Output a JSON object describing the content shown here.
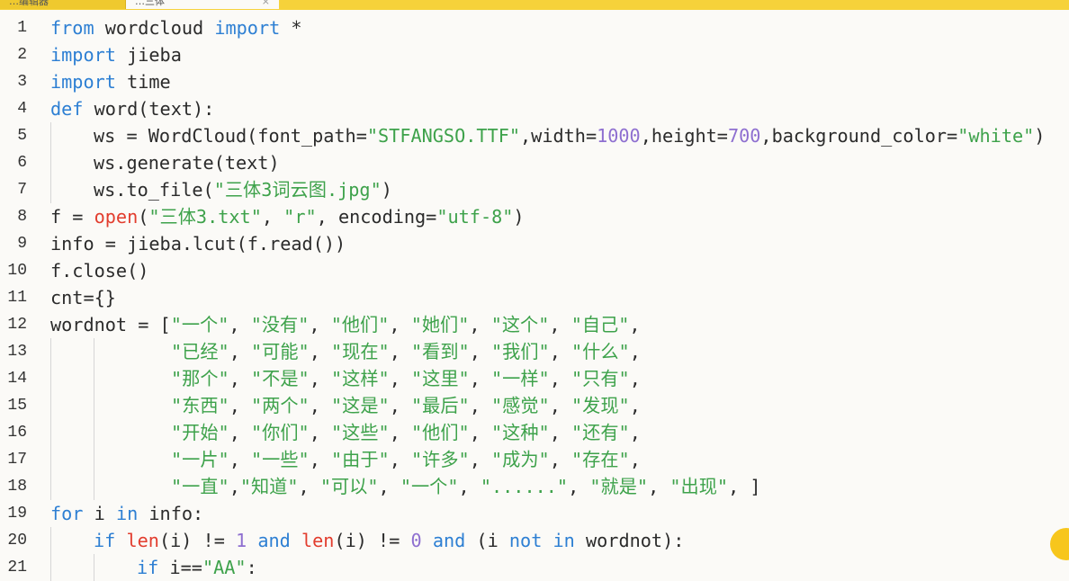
{
  "tabs": [
    {
      "label": "…编辑器"
    },
    {
      "label": "…三体",
      "close_label": "×"
    }
  ],
  "colors": {
    "keyword": "#2d7fd3",
    "string": "#3ea24b",
    "number": "#8e6fd0",
    "builtin": "#e23d2e",
    "text": "#2b2b2b",
    "tabbar": "#f6d23a"
  },
  "editor": {
    "language": "python",
    "lines": [
      {
        "n": "1",
        "indent": 0,
        "tokens": [
          [
            "kw",
            "from"
          ],
          [
            "t",
            " wordcloud "
          ],
          [
            "kw",
            "import"
          ],
          [
            "t",
            " *"
          ]
        ]
      },
      {
        "n": "2",
        "indent": 0,
        "tokens": [
          [
            "kw",
            "import"
          ],
          [
            "t",
            " jieba"
          ]
        ]
      },
      {
        "n": "3",
        "indent": 0,
        "tokens": [
          [
            "kw",
            "import"
          ],
          [
            "t",
            " time"
          ]
        ]
      },
      {
        "n": "4",
        "indent": 0,
        "tokens": [
          [
            "kw",
            "def"
          ],
          [
            "t",
            " word(text):"
          ]
        ]
      },
      {
        "n": "5",
        "indent": 1,
        "tokens": [
          [
            "t",
            "ws = WordCloud(font_path="
          ],
          [
            "str",
            "\"STFANGSO.TTF\""
          ],
          [
            "t",
            ",width="
          ],
          [
            "num",
            "1000"
          ],
          [
            "t",
            ",height="
          ],
          [
            "num",
            "700"
          ],
          [
            "t",
            ",background_color="
          ],
          [
            "str",
            "\"white\""
          ],
          [
            "t",
            ")"
          ]
        ]
      },
      {
        "n": "6",
        "indent": 1,
        "tokens": [
          [
            "t",
            "ws.generate(text)"
          ]
        ]
      },
      {
        "n": "7",
        "indent": 1,
        "tokens": [
          [
            "t",
            "ws.to_file("
          ],
          [
            "str",
            "\"三体3词云图.jpg\""
          ],
          [
            "t",
            ")"
          ]
        ]
      },
      {
        "n": "8",
        "indent": 0,
        "tokens": [
          [
            "t",
            "f = "
          ],
          [
            "bi",
            "open"
          ],
          [
            "t",
            "("
          ],
          [
            "str",
            "\"三体3.txt\""
          ],
          [
            "t",
            ", "
          ],
          [
            "str",
            "\"r\""
          ],
          [
            "t",
            ", encoding="
          ],
          [
            "str",
            "\"utf-8\""
          ],
          [
            "t",
            ")"
          ]
        ]
      },
      {
        "n": "9",
        "indent": 0,
        "tokens": [
          [
            "t",
            "info = jieba.lcut(f.read())"
          ]
        ]
      },
      {
        "n": "10",
        "indent": 0,
        "tokens": [
          [
            "t",
            "f.close()"
          ]
        ]
      },
      {
        "n": "11",
        "indent": 0,
        "tokens": [
          [
            "t",
            "cnt={}"
          ]
        ]
      },
      {
        "n": "12",
        "indent": 0,
        "tokens": [
          [
            "t",
            "wordnot = ["
          ],
          [
            "str",
            "\"一个\""
          ],
          [
            "t",
            ", "
          ],
          [
            "str",
            "\"没有\""
          ],
          [
            "t",
            ", "
          ],
          [
            "str",
            "\"他们\""
          ],
          [
            "t",
            ", "
          ],
          [
            "str",
            "\"她们\""
          ],
          [
            "t",
            ", "
          ],
          [
            "str",
            "\"这个\""
          ],
          [
            "t",
            ", "
          ],
          [
            "str",
            "\"自己\""
          ],
          [
            "t",
            ","
          ]
        ]
      },
      {
        "n": "13",
        "indent": 0,
        "cont": true,
        "tokens": [
          [
            "str",
            "\"已经\""
          ],
          [
            "t",
            ", "
          ],
          [
            "str",
            "\"可能\""
          ],
          [
            "t",
            ", "
          ],
          [
            "str",
            "\"现在\""
          ],
          [
            "t",
            ", "
          ],
          [
            "str",
            "\"看到\""
          ],
          [
            "t",
            ", "
          ],
          [
            "str",
            "\"我们\""
          ],
          [
            "t",
            ", "
          ],
          [
            "str",
            "\"什么\""
          ],
          [
            "t",
            ","
          ]
        ]
      },
      {
        "n": "14",
        "indent": 0,
        "cont": true,
        "tokens": [
          [
            "str",
            "\"那个\""
          ],
          [
            "t",
            ", "
          ],
          [
            "str",
            "\"不是\""
          ],
          [
            "t",
            ", "
          ],
          [
            "str",
            "\"这样\""
          ],
          [
            "t",
            ", "
          ],
          [
            "str",
            "\"这里\""
          ],
          [
            "t",
            ", "
          ],
          [
            "str",
            "\"一样\""
          ],
          [
            "t",
            ", "
          ],
          [
            "str",
            "\"只有\""
          ],
          [
            "t",
            ","
          ]
        ]
      },
      {
        "n": "15",
        "indent": 0,
        "cont": true,
        "tokens": [
          [
            "str",
            "\"东西\""
          ],
          [
            "t",
            ", "
          ],
          [
            "str",
            "\"两个\""
          ],
          [
            "t",
            ", "
          ],
          [
            "str",
            "\"这是\""
          ],
          [
            "t",
            ", "
          ],
          [
            "str",
            "\"最后\""
          ],
          [
            "t",
            ", "
          ],
          [
            "str",
            "\"感觉\""
          ],
          [
            "t",
            ", "
          ],
          [
            "str",
            "\"发现\""
          ],
          [
            "t",
            ","
          ]
        ]
      },
      {
        "n": "16",
        "indent": 0,
        "cont": true,
        "tokens": [
          [
            "str",
            "\"开始\""
          ],
          [
            "t",
            ", "
          ],
          [
            "str",
            "\"你们\""
          ],
          [
            "t",
            ", "
          ],
          [
            "str",
            "\"这些\""
          ],
          [
            "t",
            ", "
          ],
          [
            "str",
            "\"他们\""
          ],
          [
            "t",
            ", "
          ],
          [
            "str",
            "\"这种\""
          ],
          [
            "t",
            ", "
          ],
          [
            "str",
            "\"还有\""
          ],
          [
            "t",
            ","
          ]
        ]
      },
      {
        "n": "17",
        "indent": 0,
        "cont": true,
        "tokens": [
          [
            "str",
            "\"一片\""
          ],
          [
            "t",
            ", "
          ],
          [
            "str",
            "\"一些\""
          ],
          [
            "t",
            ", "
          ],
          [
            "str",
            "\"由于\""
          ],
          [
            "t",
            ", "
          ],
          [
            "str",
            "\"许多\""
          ],
          [
            "t",
            ", "
          ],
          [
            "str",
            "\"成为\""
          ],
          [
            "t",
            ", "
          ],
          [
            "str",
            "\"存在\""
          ],
          [
            "t",
            ","
          ]
        ]
      },
      {
        "n": "18",
        "indent": 0,
        "cont": true,
        "tokens": [
          [
            "str",
            "\"一直\""
          ],
          [
            "t",
            ","
          ],
          [
            "str",
            "\"知道\""
          ],
          [
            "t",
            ", "
          ],
          [
            "str",
            "\"可以\""
          ],
          [
            "t",
            ", "
          ],
          [
            "str",
            "\"一个\""
          ],
          [
            "t",
            ", "
          ],
          [
            "str",
            "\"......\""
          ],
          [
            "t",
            ", "
          ],
          [
            "str",
            "\"就是\""
          ],
          [
            "t",
            ", "
          ],
          [
            "str",
            "\"出现\""
          ],
          [
            "t",
            ", ]"
          ]
        ]
      },
      {
        "n": "19",
        "indent": 0,
        "tokens": [
          [
            "kw",
            "for"
          ],
          [
            "t",
            " i "
          ],
          [
            "kw",
            "in"
          ],
          [
            "t",
            " info:"
          ]
        ]
      },
      {
        "n": "20",
        "indent": 1,
        "tokens": [
          [
            "kw",
            "if"
          ],
          [
            "t",
            " "
          ],
          [
            "bi",
            "len"
          ],
          [
            "t",
            "(i) != "
          ],
          [
            "num",
            "1"
          ],
          [
            "t",
            " "
          ],
          [
            "kw",
            "and"
          ],
          [
            "t",
            " "
          ],
          [
            "bi",
            "len"
          ],
          [
            "t",
            "(i) != "
          ],
          [
            "num",
            "0"
          ],
          [
            "t",
            " "
          ],
          [
            "kw",
            "and"
          ],
          [
            "t",
            " (i "
          ],
          [
            "kw",
            "not"
          ],
          [
            "t",
            " "
          ],
          [
            "kw",
            "in"
          ],
          [
            "t",
            " wordnot):"
          ]
        ]
      },
      {
        "n": "21",
        "indent": 2,
        "tokens": [
          [
            "kw",
            "if"
          ],
          [
            "t",
            " i=="
          ],
          [
            "str",
            "\"AA\""
          ],
          [
            "t",
            ":"
          ]
        ]
      }
    ]
  }
}
